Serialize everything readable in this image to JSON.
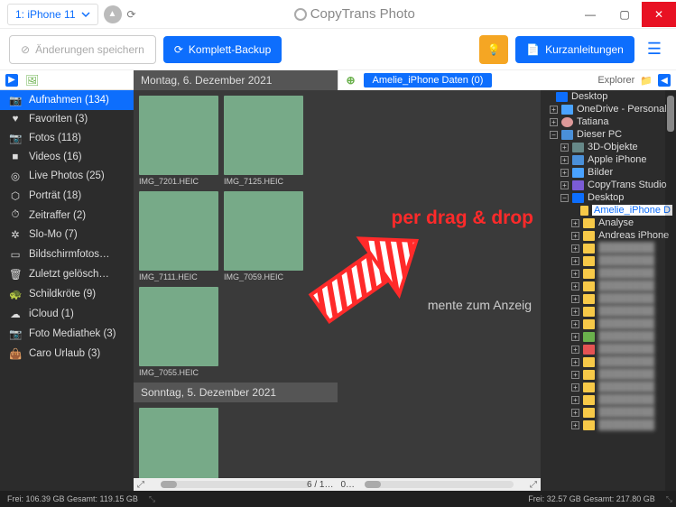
{
  "titlebar": {
    "device": "1: iPhone 11",
    "brand": "CopyTrans Photo"
  },
  "toolbar": {
    "save_changes": "Änderungen speichern",
    "full_backup": "Komplett-Backup",
    "quick_guides": "Kurzanleitungen"
  },
  "left": {
    "categories": [
      {
        "icon": "📷",
        "label": "Aufnahmen (134)",
        "active": true
      },
      {
        "icon": "♥",
        "label": "Favoriten (3)"
      },
      {
        "icon": "📷",
        "label": "Fotos (118)"
      },
      {
        "icon": "■",
        "label": "Videos (16)"
      },
      {
        "icon": "◎",
        "label": "Live Photos (25)"
      },
      {
        "icon": "⬡",
        "label": "Porträt (18)"
      },
      {
        "icon": "⏱",
        "label": "Zeitraffer (2)"
      },
      {
        "icon": "✲",
        "label": "Slo-Mo (7)"
      },
      {
        "icon": "▭",
        "label": "Bildschirmfotos…"
      },
      {
        "icon": "🗑",
        "label": "Zuletzt gelösch…"
      },
      {
        "icon": "🐢",
        "label": "Schildkröte (9)"
      },
      {
        "icon": "☁",
        "label": "iCloud (1)"
      },
      {
        "icon": "📷",
        "label": "Foto Mediathek (3)"
      },
      {
        "icon": "👜",
        "label": "Caro Urlaub (3)"
      }
    ]
  },
  "mid": {
    "date1": "Montag, 6. Dezember 2021",
    "date2": "Sonntag, 5. Dezember 2021",
    "thumbs": [
      "IMG_7201.HEIC",
      "IMG_7125.HEIC",
      "IMG_7111.HEIC",
      "IMG_7059.HEIC",
      "IMG_7055.HEIC"
    ],
    "page": "6 / 1…"
  },
  "drop": {
    "folder_tag": "Amelie_iPhone Daten (0)",
    "overlay": "per drag & drop",
    "hint": "mente zum Anzeig",
    "zero": "0…"
  },
  "right": {
    "title": "Explorer",
    "tree": {
      "desktop": "Desktop",
      "onedrive": "OneDrive - Personal",
      "tatiana": "Tatiana",
      "thispc": "Dieser PC",
      "objects3d": "3D-Objekte",
      "appleiphone": "Apple iPhone",
      "bilder": "Bilder",
      "ctstudio": "CopyTrans Studio",
      "desktop2": "Desktop",
      "amelie": "Amelie_iPhone D",
      "analyse": "Analyse",
      "andreas": "Andreas iPhone"
    }
  },
  "status": {
    "left": "Frei: 106.39 GB Gesamt: 119.15 GB",
    "right": "Frei: 32.57 GB Gesamt: 217.80 GB"
  }
}
